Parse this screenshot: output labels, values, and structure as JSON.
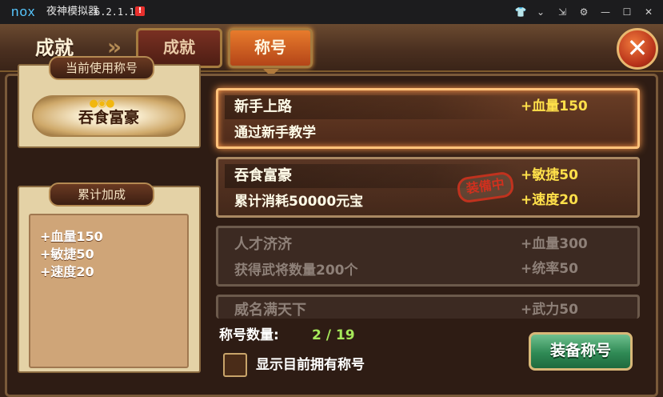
{
  "emulator": {
    "logo": "nox",
    "app_name": "夜神模拟器",
    "version": "6.2.1.1",
    "alert_badge": "!",
    "controls": [
      {
        "icon": "tshirt-icon",
        "glyph": "👕"
      },
      {
        "icon": "chevron-down-icon",
        "glyph": "⌄"
      },
      {
        "icon": "pin-icon",
        "glyph": "⇲"
      },
      {
        "icon": "settings-icon",
        "glyph": "⚙"
      },
      {
        "icon": "minimize-icon",
        "glyph": "—"
      },
      {
        "icon": "maximize-icon",
        "glyph": "☐"
      },
      {
        "icon": "close-icon",
        "glyph": "✕"
      }
    ]
  },
  "header": {
    "title": "成就",
    "breadcrumb_arrow": "»",
    "tabs": [
      {
        "label": "成就",
        "active": false
      },
      {
        "label": "称号",
        "active": true
      }
    ],
    "close_glyph": "✕"
  },
  "left_panel": {
    "current_label": "当前使用称号",
    "current_title": "吞食富豪",
    "gold_glyph": "●◉●",
    "bonus_label": "累计加成",
    "bonuses": [
      "+血量150",
      "+敏捷50",
      "+速度20"
    ]
  },
  "titles": [
    {
      "name": "新手上路",
      "desc": "通过新手教学",
      "stats": [
        "+血量150",
        ""
      ],
      "state": "selected"
    },
    {
      "name": "吞食富豪",
      "desc": "累计消耗50000元宝",
      "stats": [
        "+敏捷50",
        "+速度20"
      ],
      "state": "equipped"
    },
    {
      "name": "人才济济",
      "desc": "获得武将数量200个",
      "stats": [
        "+血量300",
        "+统率50"
      ],
      "state": "locked"
    },
    {
      "name": "威名满天下",
      "desc": "",
      "stats": [
        "+武力50",
        ""
      ],
      "state": "locked"
    }
  ],
  "equipped_stamp": "装備中",
  "footer": {
    "count_label": "称号数量:",
    "count_value": "2 / 19",
    "owned_checkbox_label": "显示目前拥有称号",
    "owned_checked": false,
    "equip_button": "装备称号"
  },
  "colors": {
    "stat_yellow": "#ffe04a",
    "locked_gray": "#8e8078",
    "count_green": "#a6e85a",
    "equip_green": "#2f8a55",
    "tab_active_orange": "#e77b2c"
  }
}
